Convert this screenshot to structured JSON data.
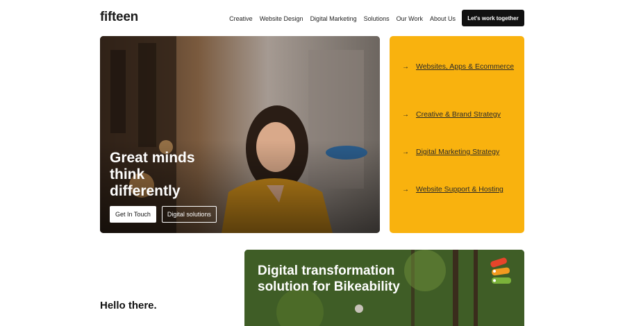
{
  "header": {
    "logo": "fifteen",
    "nav": [
      "Creative",
      "Website Design",
      "Digital Marketing",
      "Solutions",
      "Our Work",
      "About Us"
    ],
    "cta": "Let's work together"
  },
  "hero": {
    "title": "Great minds\nthink\ndifferently",
    "primary_button": "Get In Touch",
    "secondary_button": "Digital solutions"
  },
  "services": {
    "items": [
      "Websites, Apps & Ecommerce",
      "Creative & Brand Strategy",
      "Digital Marketing Strategy",
      "Website Support & Hosting"
    ]
  },
  "intro": {
    "heading": "Hello there."
  },
  "case_study": {
    "title": "Digital transformation\nsolution for Bikeability"
  },
  "colors": {
    "accent": "#f9b20e",
    "dark": "#111111",
    "background": "#ffffff"
  },
  "icons": {
    "service_arrow": "arrow-right-icon"
  }
}
